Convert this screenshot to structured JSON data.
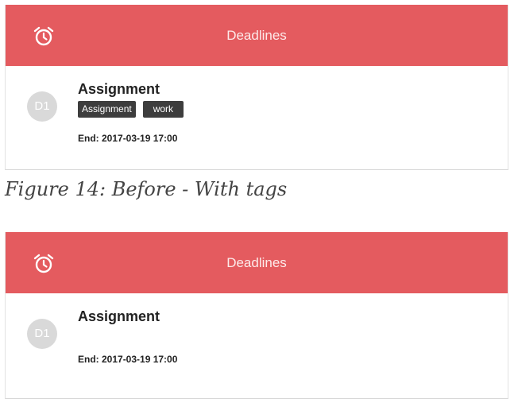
{
  "before": {
    "header_title": "Deadlines",
    "icon": "alarm-clock-icon",
    "item": {
      "avatar": "D1",
      "title": "Assignment",
      "tags": [
        "Assignment",
        "work"
      ],
      "end": "End: 2017-03-19 17:00"
    }
  },
  "caption": "Figure 14: Before - With tags",
  "after": {
    "header_title": "Deadlines",
    "icon": "alarm-clock-icon",
    "item": {
      "avatar": "D1",
      "title": "Assignment",
      "end": "End: 2017-03-19 17:00"
    }
  },
  "colors": {
    "header": "#e45b5f",
    "tag": "#3d3d3d",
    "avatar": "#d9d9d9"
  }
}
